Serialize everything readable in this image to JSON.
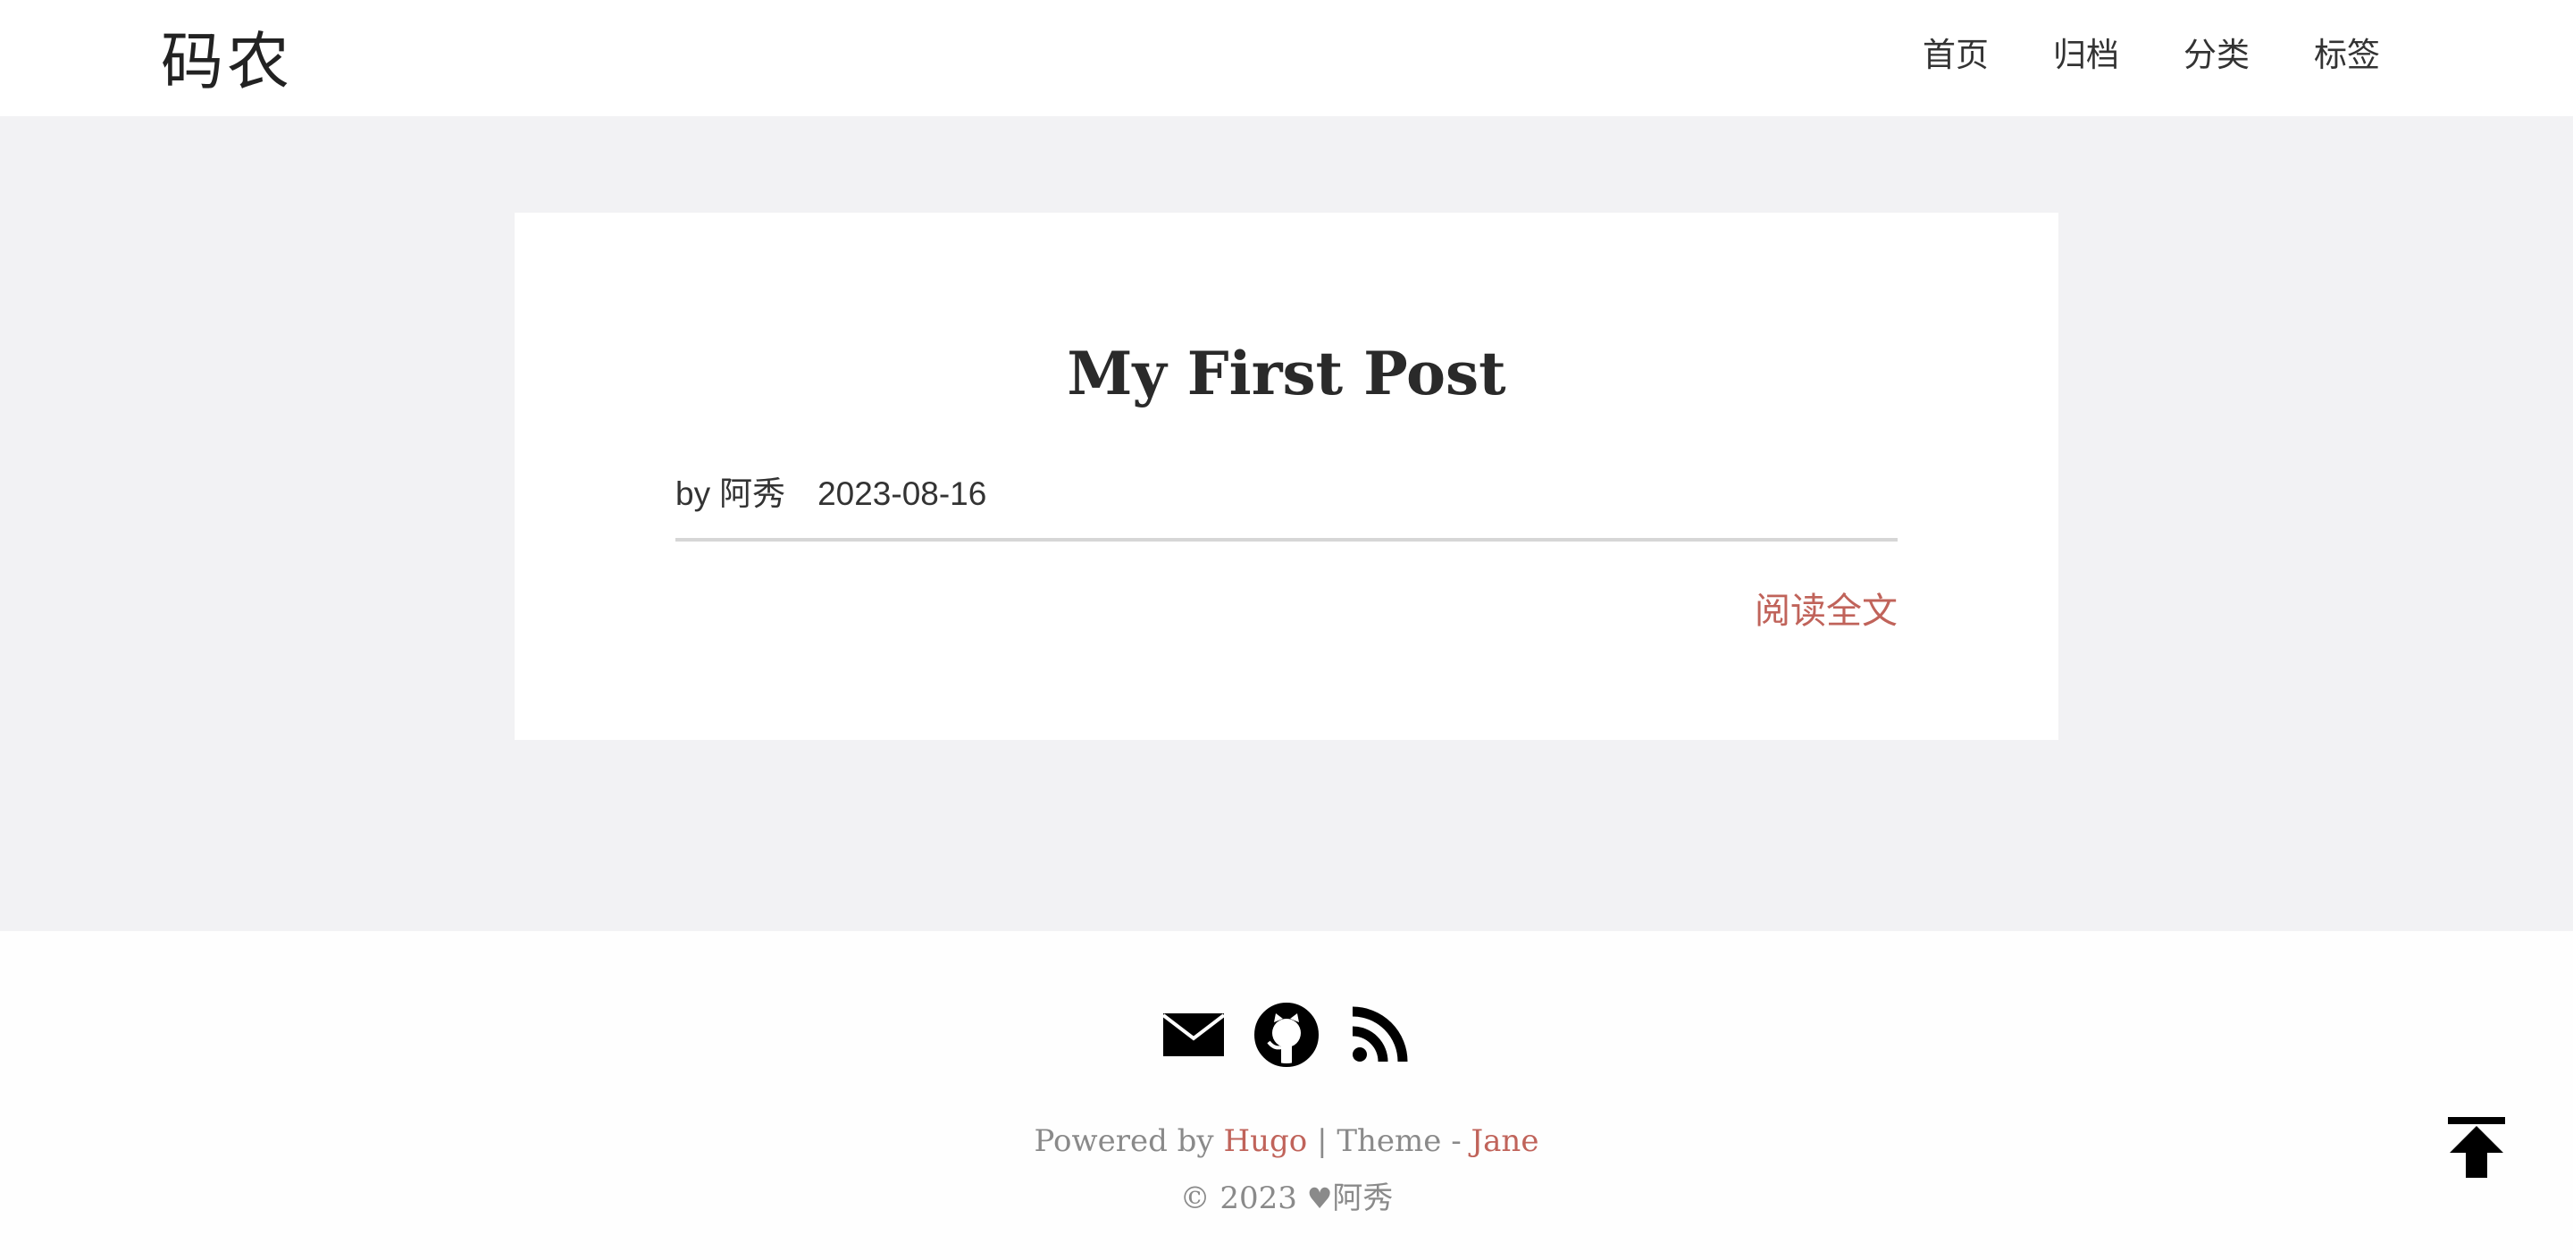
{
  "header": {
    "logo": "码农",
    "nav": [
      {
        "label": "首页"
      },
      {
        "label": "归档"
      },
      {
        "label": "分类"
      },
      {
        "label": "标签"
      }
    ]
  },
  "post": {
    "title": "My First Post",
    "by_label": "by",
    "author": "阿秀",
    "date": "2023-08-16",
    "read_more": "阅读全文"
  },
  "footer": {
    "social_icons": [
      "envelope-icon",
      "github-icon",
      "rss-icon"
    ],
    "powered_by_label": "Powered by",
    "hugo_link": "Hugo",
    "separator": "|",
    "theme_label": "Theme -",
    "theme_link": "Jane",
    "copyright_year": "© 2023",
    "copyright_name": "阿秀"
  },
  "colors": {
    "accent": "#c0635a",
    "page_bg": "#f2f2f4",
    "card_bg": "#ffffff",
    "text": "#333333",
    "muted": "#8a8a8a"
  }
}
